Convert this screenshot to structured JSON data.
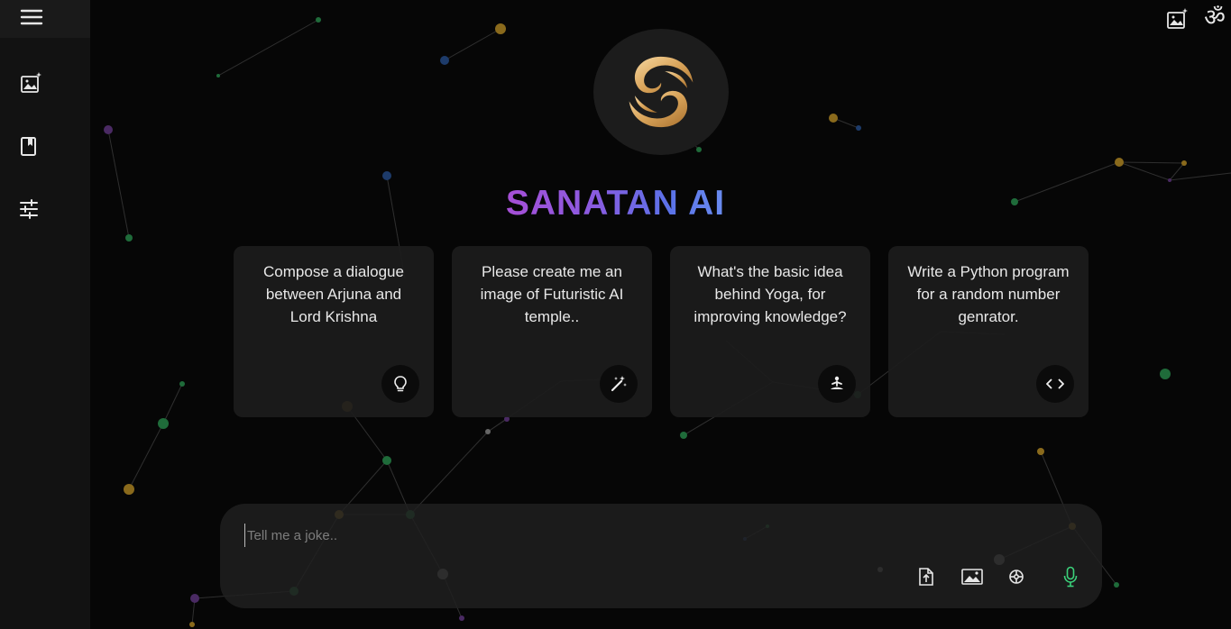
{
  "app": {
    "title": "SANATAN AI"
  },
  "sidebar": {
    "items": [
      {
        "icon": "menu-icon"
      },
      {
        "icon": "image-sparkle-icon"
      },
      {
        "icon": "bookmark-icon"
      },
      {
        "icon": "sliders-icon"
      }
    ]
  },
  "header": {
    "right_icons": [
      "image-sparkle-icon",
      "om-icon"
    ],
    "om_symbol": "ॐ"
  },
  "suggestions": [
    {
      "text": "Compose a dialogue between Arjuna and Lord Krishna",
      "icon": "lightbulb-icon"
    },
    {
      "text": "Please create me an image of Futuristic AI temple..",
      "icon": "magic-wand-icon"
    },
    {
      "text": "What's the basic idea behind Yoga, for improving knowledge?",
      "icon": "meditation-icon"
    },
    {
      "text": "Write a Python program for a random number genrator.",
      "icon": "code-icon"
    }
  ],
  "composer": {
    "placeholder": "Tell me a joke..",
    "value": "",
    "tools": [
      "file-upload-icon",
      "image-icon",
      "settings-icon",
      "microphone-icon"
    ]
  },
  "colors": {
    "background": "#060606",
    "sidebar": "#121212",
    "card": "#1c1c1c",
    "logo_gold": "#d9a45a",
    "title_gradient_start": "#a64fd6",
    "title_gradient_end": "#6a8cf0",
    "mic": "#3bd17a"
  }
}
